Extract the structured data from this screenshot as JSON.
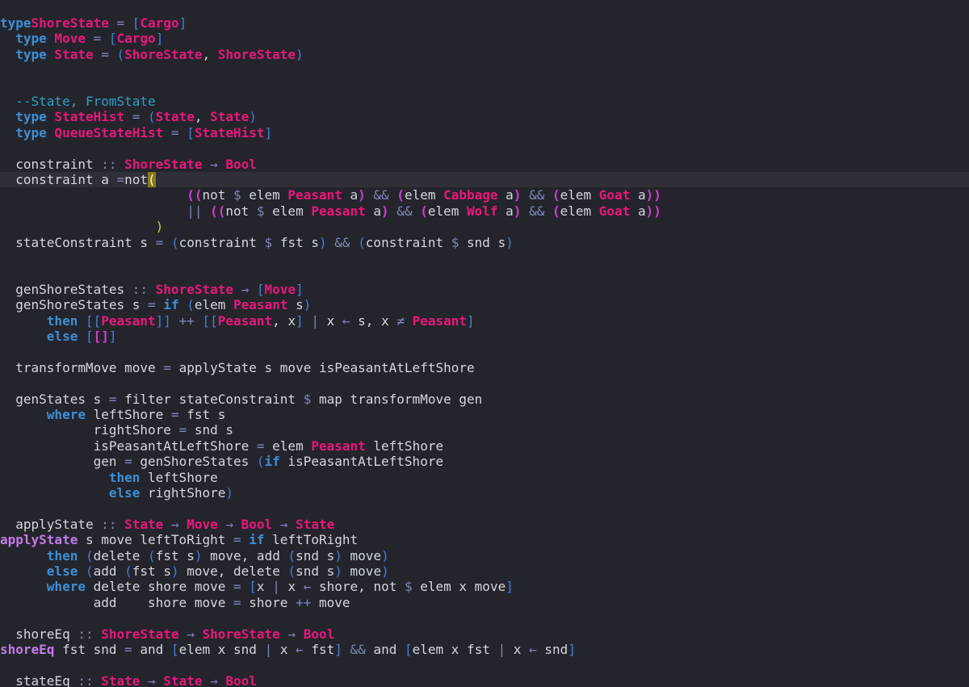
{
  "colors": {
    "background": "#24252c",
    "text": "#d6d6dd",
    "keyword": "#3d8fd6",
    "type": "#e8177b",
    "operator": "#7d86b8",
    "bracket": "#4a7bd6",
    "bracket_magenta": "#d23ccf",
    "bracket_green": "#b7d63a",
    "comment": "#2f9fc4",
    "function_def": "#c27ce8",
    "cursor": "#8a7a1a",
    "current_line": "#2e2f37"
  },
  "code_lines": [
    [
      [
        "kw",
        "type"
      ],
      [
        "",
        ""
      ],
      [
        "ty",
        "ShoreState"
      ],
      [
        "op",
        " = "
      ],
      [
        "br",
        "["
      ],
      [
        "ty",
        "Cargo"
      ],
      [
        "br",
        "]"
      ]
    ],
    [
      [
        "",
        "  "
      ],
      [
        "kw",
        "type"
      ],
      [
        "ty",
        " Move"
      ],
      [
        "op",
        " = "
      ],
      [
        "br",
        "["
      ],
      [
        "ty",
        "Cargo"
      ],
      [
        "br",
        "]"
      ]
    ],
    [
      [
        "",
        "  "
      ],
      [
        "kw",
        "type"
      ],
      [
        "ty",
        " State"
      ],
      [
        "op",
        " = "
      ],
      [
        "br",
        "("
      ],
      [
        "ty",
        "ShoreState"
      ],
      [
        "",
        ", "
      ],
      [
        "ty",
        "ShoreState"
      ],
      [
        "br",
        ")"
      ]
    ],
    [],
    [],
    [
      [
        "cm",
        "  --State, FromState"
      ]
    ],
    [
      [
        "",
        "  "
      ],
      [
        "kw",
        "type"
      ],
      [
        "ty",
        " StateHist"
      ],
      [
        "op",
        " = "
      ],
      [
        "br",
        "("
      ],
      [
        "ty",
        "State"
      ],
      [
        "",
        ", "
      ],
      [
        "ty",
        "State"
      ],
      [
        "br",
        ")"
      ]
    ],
    [
      [
        "",
        "  "
      ],
      [
        "kw",
        "type"
      ],
      [
        "ty",
        " QueueStateHist"
      ],
      [
        "op",
        " = "
      ],
      [
        "br",
        "["
      ],
      [
        "ty",
        "StateHist"
      ],
      [
        "br",
        "]"
      ]
    ],
    [],
    [
      [
        "",
        "  constraint "
      ],
      [
        "op",
        "::"
      ],
      [
        "ty",
        " ShoreState"
      ],
      [
        "op",
        " → "
      ],
      [
        "ty",
        "Bool"
      ]
    ],
    [
      [
        "",
        "  constraint a "
      ],
      [
        "op",
        "="
      ],
      [
        "",
        ""
      ],
      [
        "",
        ""
      ],
      [
        "",
        ""
      ],
      [
        "",
        ""
      ],
      [
        "",
        ""
      ],
      [
        "",
        ""
      ],
      [
        "",
        "not"
      ],
      [
        "cur",
        "("
      ]
    ],
    [
      [
        "",
        "                        "
      ],
      [
        "brm",
        "(("
      ],
      [
        "",
        "not "
      ],
      [
        "op",
        "$"
      ],
      [
        "",
        " elem "
      ],
      [
        "ty",
        "Peasant"
      ],
      [
        "",
        " a"
      ],
      [
        "brm",
        ")"
      ],
      [
        "op",
        " && "
      ],
      [
        "brm",
        "("
      ],
      [
        "",
        "elem "
      ],
      [
        "ty",
        "Cabbage"
      ],
      [
        "",
        " a"
      ],
      [
        "brm",
        ")"
      ],
      [
        "op",
        " && "
      ],
      [
        "brm",
        "("
      ],
      [
        "",
        "elem "
      ],
      [
        "ty",
        "Goat"
      ],
      [
        "",
        " a"
      ],
      [
        "brm",
        "))"
      ]
    ],
    [
      [
        "",
        "                        "
      ],
      [
        "op",
        "||"
      ],
      [
        "",
        ""
      ],
      [
        "brm",
        " (("
      ],
      [
        "",
        "not "
      ],
      [
        "op",
        "$"
      ],
      [
        "",
        " elem "
      ],
      [
        "ty",
        "Peasant"
      ],
      [
        "",
        " a"
      ],
      [
        "brm",
        ")"
      ],
      [
        "op",
        " && "
      ],
      [
        "brm",
        "("
      ],
      [
        "",
        "elem "
      ],
      [
        "ty",
        "Wolf"
      ],
      [
        "",
        " a"
      ],
      [
        "brm",
        ")"
      ],
      [
        "op",
        " && "
      ],
      [
        "brm",
        "("
      ],
      [
        "",
        "elem "
      ],
      [
        "ty",
        "Goat"
      ],
      [
        "",
        " a"
      ],
      [
        "brm",
        "))"
      ]
    ],
    [
      [
        "",
        "                    "
      ],
      [
        "gr",
        ")"
      ]
    ],
    [
      [
        "",
        "  stateConstraint s "
      ],
      [
        "op",
        "="
      ],
      [
        "",
        " "
      ],
      [
        "br",
        "("
      ],
      [
        "",
        "constraint "
      ],
      [
        "op",
        "$"
      ],
      [
        "",
        " fst s"
      ],
      [
        "br",
        ")"
      ],
      [
        "op",
        " && "
      ],
      [
        "br",
        "("
      ],
      [
        "",
        "constraint "
      ],
      [
        "op",
        "$"
      ],
      [
        "",
        " snd s"
      ],
      [
        "br",
        ")"
      ]
    ],
    [],
    [],
    [
      [
        "",
        "  genShoreStates "
      ],
      [
        "op",
        "::"
      ],
      [
        "ty",
        " ShoreState"
      ],
      [
        "op",
        " → "
      ],
      [
        "br",
        "["
      ],
      [
        "ty",
        "Move"
      ],
      [
        "br",
        "]"
      ]
    ],
    [
      [
        "",
        "  genShoreStates s "
      ],
      [
        "op",
        "="
      ],
      [
        "kw",
        " if"
      ],
      [
        "",
        " "
      ],
      [
        "br",
        "("
      ],
      [
        "",
        "elem "
      ],
      [
        "ty",
        "Peasant"
      ],
      [
        "",
        " s"
      ],
      [
        "br",
        ")"
      ]
    ],
    [
      [
        "",
        "      "
      ],
      [
        "kw",
        "then"
      ],
      [
        "",
        " "
      ],
      [
        "br",
        "[["
      ],
      [
        "ty",
        "Peasant"
      ],
      [
        "br",
        "]]"
      ],
      [
        "op",
        " ++ "
      ],
      [
        "br",
        "[["
      ],
      [
        "ty",
        "Peasant"
      ],
      [
        "",
        ", x"
      ],
      [
        "br",
        "]"
      ],
      [
        "op",
        " | "
      ],
      [
        "",
        "x "
      ],
      [
        "op",
        "←"
      ],
      [
        "",
        ""
      ],
      [
        "",
        " s, x "
      ],
      [
        "op",
        "≠"
      ],
      [
        "ty",
        " Peasant"
      ],
      [
        "br",
        "]"
      ]
    ],
    [
      [
        "",
        "      "
      ],
      [
        "kw",
        "else"
      ],
      [
        "",
        " "
      ],
      [
        "br",
        "["
      ],
      [
        "brc",
        "[]"
      ],
      [
        "br",
        "]"
      ]
    ],
    [],
    [
      [
        "",
        "  transformMove move "
      ],
      [
        "op",
        "="
      ],
      [
        "",
        " applyState s move isPeasantAtLeftShore"
      ]
    ],
    [],
    [
      [
        "",
        "  genStates s "
      ],
      [
        "op",
        "="
      ],
      [
        "",
        " filter stateConstraint "
      ],
      [
        "op",
        "$"
      ],
      [
        "",
        " map transformMove gen"
      ]
    ],
    [
      [
        "",
        "      "
      ],
      [
        "kw",
        "where"
      ],
      [
        "",
        " leftShore "
      ],
      [
        "op",
        "="
      ],
      [
        "",
        " fst s"
      ]
    ],
    [
      [
        "",
        "            rightShore "
      ],
      [
        "op",
        "="
      ],
      [
        "",
        " snd s"
      ]
    ],
    [
      [
        "",
        "            isPeasantAtLeftShore "
      ],
      [
        "op",
        "="
      ],
      [
        "",
        " elem "
      ],
      [
        "ty",
        "Peasant"
      ],
      [
        "",
        " leftShore"
      ]
    ],
    [
      [
        "",
        "            gen "
      ],
      [
        "op",
        "="
      ],
      [
        "",
        " genShoreStates "
      ],
      [
        "br",
        "("
      ],
      [
        "kw",
        "if"
      ],
      [
        "",
        " isPeasantAtLeftShore"
      ]
    ],
    [
      [
        "",
        "              "
      ],
      [
        "kw",
        "then"
      ],
      [
        "",
        " leftShore"
      ]
    ],
    [
      [
        "",
        "              "
      ],
      [
        "kw",
        "else"
      ],
      [
        "",
        " rightShore"
      ],
      [
        "br",
        ")"
      ]
    ],
    [],
    [
      [
        "",
        "  applyState "
      ],
      [
        "op",
        "::"
      ],
      [
        "ty",
        " State"
      ],
      [
        "op",
        " → "
      ],
      [
        "ty",
        "Move"
      ],
      [
        "op",
        " → "
      ],
      [
        "ty",
        "Bool"
      ],
      [
        "op",
        " → "
      ],
      [
        "ty",
        "State"
      ]
    ],
    [
      [
        "fn",
        "applyState"
      ],
      [
        "",
        " s move leftToRight "
      ],
      [
        "op",
        "="
      ],
      [
        "kw",
        " if"
      ],
      [
        "",
        " leftToRight"
      ]
    ],
    [
      [
        "",
        "      "
      ],
      [
        "kw",
        "then"
      ],
      [
        "",
        " "
      ],
      [
        "br",
        "("
      ],
      [
        "",
        "delete "
      ],
      [
        "br",
        "("
      ],
      [
        "",
        "fst s"
      ],
      [
        "br",
        ")"
      ],
      [
        "",
        " move, add "
      ],
      [
        "br",
        "("
      ],
      [
        "",
        "snd s"
      ],
      [
        "br",
        ")"
      ],
      [
        "",
        " move"
      ],
      [
        "br",
        ")"
      ]
    ],
    [
      [
        "",
        "      "
      ],
      [
        "kw",
        "else"
      ],
      [
        "",
        " "
      ],
      [
        "br",
        "("
      ],
      [
        "",
        "add "
      ],
      [
        "br",
        "("
      ],
      [
        "",
        "fst s"
      ],
      [
        "br",
        ")"
      ],
      [
        "",
        " move, delete "
      ],
      [
        "br",
        "("
      ],
      [
        "",
        "snd s"
      ],
      [
        "br",
        ")"
      ],
      [
        "",
        " move"
      ],
      [
        "br",
        ")"
      ]
    ],
    [
      [
        "",
        "      "
      ],
      [
        "kw",
        "where"
      ],
      [
        "",
        " delete shore move "
      ],
      [
        "op",
        "="
      ],
      [
        "",
        " "
      ],
      [
        "br",
        "["
      ],
      [
        "",
        "x "
      ],
      [
        "op",
        "|"
      ],
      [
        "",
        " x "
      ],
      [
        "op",
        "←"
      ],
      [
        "",
        " shore, not "
      ],
      [
        "op",
        "$"
      ],
      [
        "",
        " elem x move"
      ],
      [
        "br",
        "]"
      ]
    ],
    [
      [
        "",
        "            add    shore move "
      ],
      [
        "op",
        "="
      ],
      [
        "",
        " shore "
      ],
      [
        "op",
        "++"
      ],
      [
        "",
        " move"
      ]
    ],
    [],
    [
      [
        "",
        "  shoreEq "
      ],
      [
        "op",
        "::"
      ],
      [
        "ty",
        " ShoreState"
      ],
      [
        "op",
        " → "
      ],
      [
        "ty",
        "ShoreState"
      ],
      [
        "op",
        " → "
      ],
      [
        "ty",
        "Bool"
      ]
    ],
    [
      [
        "fn",
        "shoreEq"
      ],
      [
        "",
        " fst snd "
      ],
      [
        "op",
        "="
      ],
      [
        "",
        " and "
      ],
      [
        "br",
        "["
      ],
      [
        "",
        "elem x snd "
      ],
      [
        "op",
        "|"
      ],
      [
        "",
        " x "
      ],
      [
        "op",
        "←"
      ],
      [
        "",
        " fst"
      ],
      [
        "br",
        "]"
      ],
      [
        "op",
        " && "
      ],
      [
        "",
        "and "
      ],
      [
        "br",
        "["
      ],
      [
        "",
        "elem x fst "
      ],
      [
        "op",
        "|"
      ],
      [
        "",
        " x "
      ],
      [
        "op",
        "←"
      ],
      [
        "",
        " snd"
      ],
      [
        "br",
        "]"
      ]
    ],
    [],
    [
      [
        "",
        "  stateEq "
      ],
      [
        "op",
        "::"
      ],
      [
        "ty",
        " State"
      ],
      [
        "op",
        " → "
      ],
      [
        "ty",
        "State"
      ],
      [
        "op",
        " → "
      ],
      [
        "ty",
        "Bool"
      ]
    ]
  ]
}
